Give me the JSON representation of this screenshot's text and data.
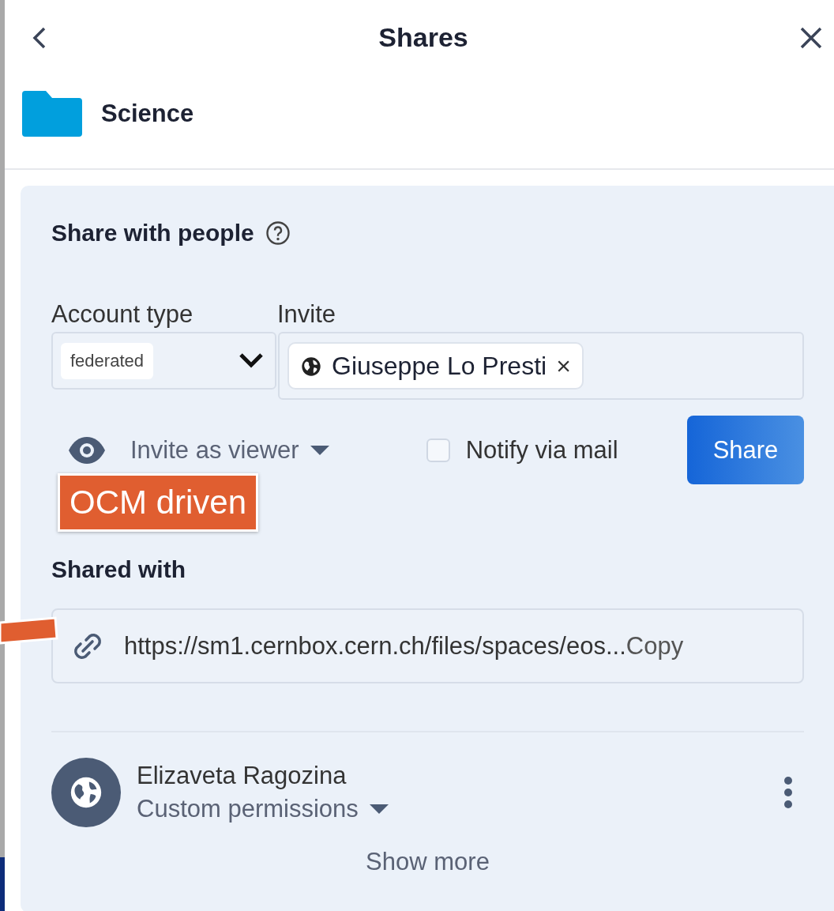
{
  "header": {
    "title": "Shares"
  },
  "resource": {
    "name": "Science"
  },
  "share_with_people": {
    "title": "Share with people",
    "account_type": {
      "label": "Account type",
      "value": "federated"
    },
    "invite": {
      "label": "Invite",
      "recipients": [
        {
          "name": "Giuseppe Lo Presti",
          "remove": "×"
        }
      ]
    },
    "role": "Invite as viewer",
    "notify": {
      "label": "Notify via mail",
      "checked": false
    },
    "share_button": "Share"
  },
  "annotation": {
    "text": "OCM driven"
  },
  "shared_with": {
    "title": "Shared with",
    "link": {
      "url": "https://sm1.cernbox.cern.ch/files/spaces/eos...",
      "copy": "Copy"
    },
    "shares": [
      {
        "name": "Elizaveta Ragozina",
        "permission": "Custom permissions"
      }
    ],
    "show_more": "Show more"
  }
}
